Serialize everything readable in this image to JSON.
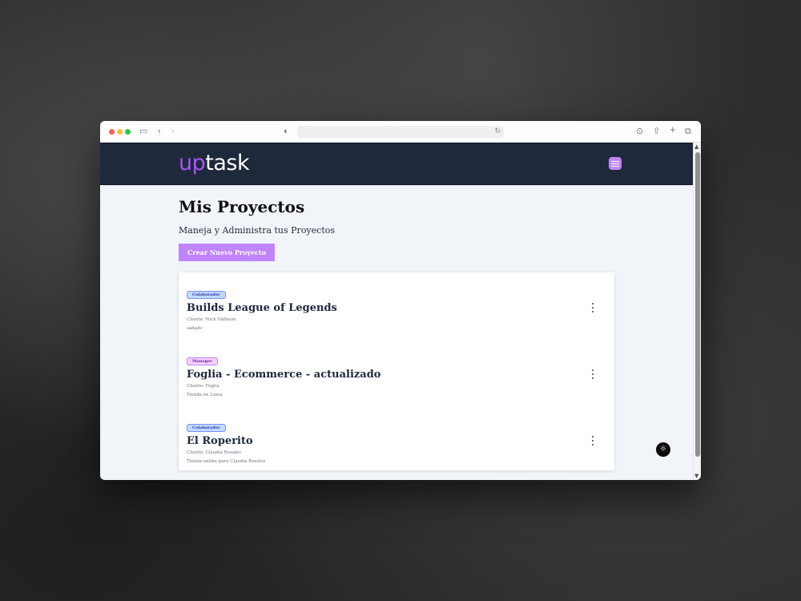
{
  "app": {
    "logo_prefix": "up",
    "logo_suffix": "task"
  },
  "browser": {
    "address_value": ""
  },
  "page": {
    "title": "Mis Proyectos",
    "subtitle": "Maneja y Administra tus Proyectos",
    "create_button": "Crear Nuevo Proyecto"
  },
  "projects": [
    {
      "role": "Colaborador",
      "name": "Builds League of Legends",
      "client": "Cliente: Nick Dalboon",
      "description": "sadads"
    },
    {
      "role": "Manager",
      "name": "Foglia - Ecommerce - actualizado",
      "client": "Cliente: Foglia",
      "description": "Tienda en Linea"
    },
    {
      "role": "Colaborador",
      "name": "El Roperito",
      "client": "Cliente: Claudia Rosales",
      "description": "Tienda online para Claudia Rosales"
    }
  ],
  "icons": {
    "menu": "hamburger-menu-icon",
    "kebab": "more-options-icon",
    "theme": "theme-toggle-icon"
  },
  "colors": {
    "accent": "#c084fc",
    "header_bg": "#1e293b",
    "page_bg": "#f1f5f9"
  }
}
